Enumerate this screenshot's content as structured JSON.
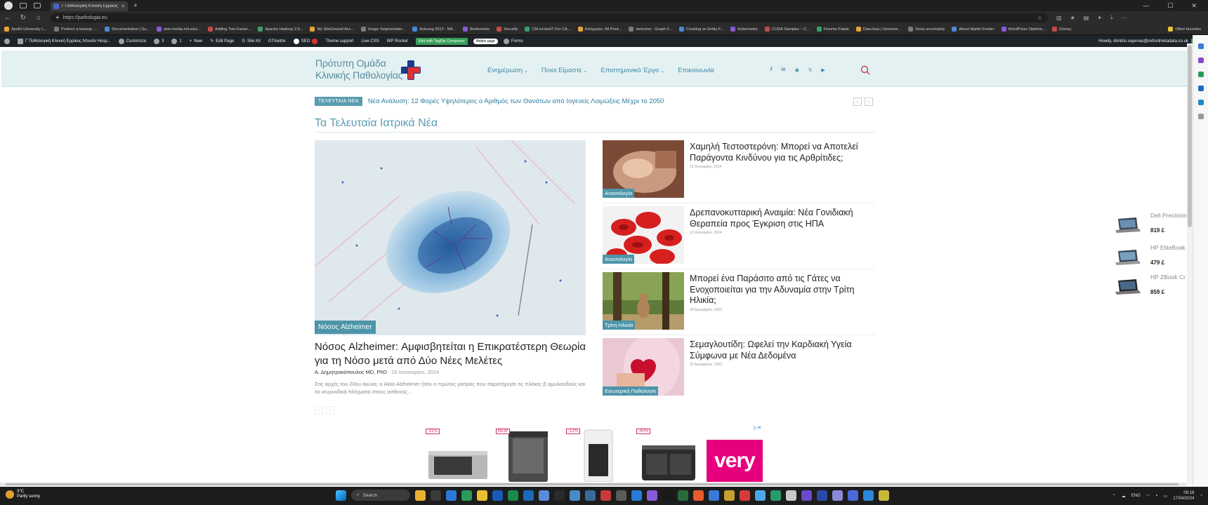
{
  "browser": {
    "tab_title": "Γ Παθολογική Κλινική Ερρίκος Ν...",
    "url": "https://pathologia.eu",
    "bookmarks": [
      "Apollo University L...",
      "Perform a backup -...",
      "Documentation | Su...",
      "web.media.mit.edu/...",
      "Adding Two-Factor...",
      "Apache Hadoop 2.9...",
      "My SiteGround Acc...",
      "Image Segmentatio...",
      "Autoseg 2013 - NA...",
      "Bookmarks",
      "Xecurify",
      "CM evolveIT For CA...",
      "Απόρρητο: All Prod...",
      "welcome - Graph F...",
      "Creating an Entity F...",
      "Kubernetes",
      "CUDA Samples :: C...",
      "Femme Fatale",
      "Data bias | Genome...",
      "Deep uncertainty",
      "About Martin Fowler",
      "WordPress Optimis...",
      "Disney"
    ],
    "other_favorites": "Other favorites"
  },
  "wp_admin": {
    "site_name": "Γ Παθολογική Κλινική Ερρίκος Ντυνάν Hosp...",
    "customize": "Customize",
    "updates": "3",
    "comments": "1",
    "new": "New",
    "edit_page": "Edit Page",
    "site_kit": "Site Kit",
    "gtmetrix": "GTmetrix",
    "seo": "SEO",
    "theme_support": "Theme support",
    "live_css": "Live CSS",
    "wp_rocket": "WP Rocket",
    "tagdiv": "Edit with TagDiv Composer",
    "mobile_page": "Mobile page",
    "forms": "Forms",
    "howdy": "Howdy, dimitris.vayenas@oxfordmetadata.co.uk"
  },
  "site": {
    "logo_line1": "Πρότυπη Ομάδα",
    "logo_line2": "Κλινικής Παθολογίας",
    "nav": [
      "Ενημέρωση",
      "Ποιοι Είμαστε",
      "Επιστημονικό Έργο",
      "Επικοινωνία"
    ],
    "social": [
      "f",
      "in",
      "rss",
      "x",
      "yt"
    ],
    "ticker_label": "ΤΕΛΕΥΤΑΙΑ ΝΕΑ",
    "ticker_text": "Νέα Ανάλυση: 12 Φορές Υψηλότερος ο Αριθμός των Θανάτων από Ιογενείς Λοιμώξεις Μέχρι το 2050",
    "section_title": "Τα Τελευταία Ιατρικά Νέα"
  },
  "hero": {
    "tag": "Νόσος Alzheimer",
    "title": "Νόσος Alzheimer: Αμφισβητείται η Επικρατέστερη Θεωρία για τη Νόσο μετά από Δύο Νέες Μελέτες",
    "author": "Α. Δημητρακόπουλος MD, PhD",
    "date": "19 Ιανουαρίου, 2024",
    "excerpt": "Στις αρχές του 20ου αιώνα, ο Alois Alzheimer ήταν ο πρώτος γιατρός που παρατήρησε τις πλάκες β αμυλοειδούς και τα νευρινιδικά πλέγματα στους ασθενείς..."
  },
  "articles": [
    {
      "title": "Χαμηλή Τεστοστερόνη: Μπορεί να Αποτελεί Παράγοντα Κινδύνου για τις Αρθρίτιδες;",
      "date": "15 Ιανουαρίου, 2024",
      "tag": "Ανασολογία"
    },
    {
      "title": "Δρεπανοκυτταρική Αναιμία: Νέα Γονιδιακή Θεραπεία προς Έγκριση στις ΗΠΑ",
      "date": "12 Ιανουαρίου, 2024",
      "tag": "Ανασολογία"
    },
    {
      "title": "Μπορεί ένα Παράσιτο από τις Γάτες να Ενοχοποιείται για την Αδυναμία στην Τρίτη Ηλικία;",
      "date": "29 Δεκεμβρίου, 2023",
      "tag": "Τρίτη Ηλικία"
    },
    {
      "title": "Σεμαγλουτίδη: Ωφελεί την Καρδιακή Υγεία Σύμφωνα με Νέα Δεδομένα",
      "date": "25 Δεκεμβρίου, 2023",
      "tag": "Εσωτερική Παθολογία"
    }
  ],
  "ad": {
    "badges": [
      "-31%",
      "NEW",
      "-12%",
      "-40%"
    ],
    "brand": "very"
  },
  "side_ads": [
    {
      "name": "Dell Precision 5550 Laptop",
      "price": "819 £"
    },
    {
      "name": "HP EliteBook G7 Laptop: 1",
      "price": "479 £"
    },
    {
      "name": "HP ZBook Cr G7 Laptop: C",
      "price": "859 £"
    }
  ],
  "taskbar": {
    "temp": "3°C",
    "weather": "Partly sunny",
    "search": "Search",
    "lang": "ENG",
    "time": "08:18",
    "date": "17/04/2024"
  },
  "colors": {
    "accent": "#3f87a5",
    "header_bg": "#e3f1f2",
    "tag_bg": "#4d95a9",
    "wp_bar": "#1d2327"
  }
}
